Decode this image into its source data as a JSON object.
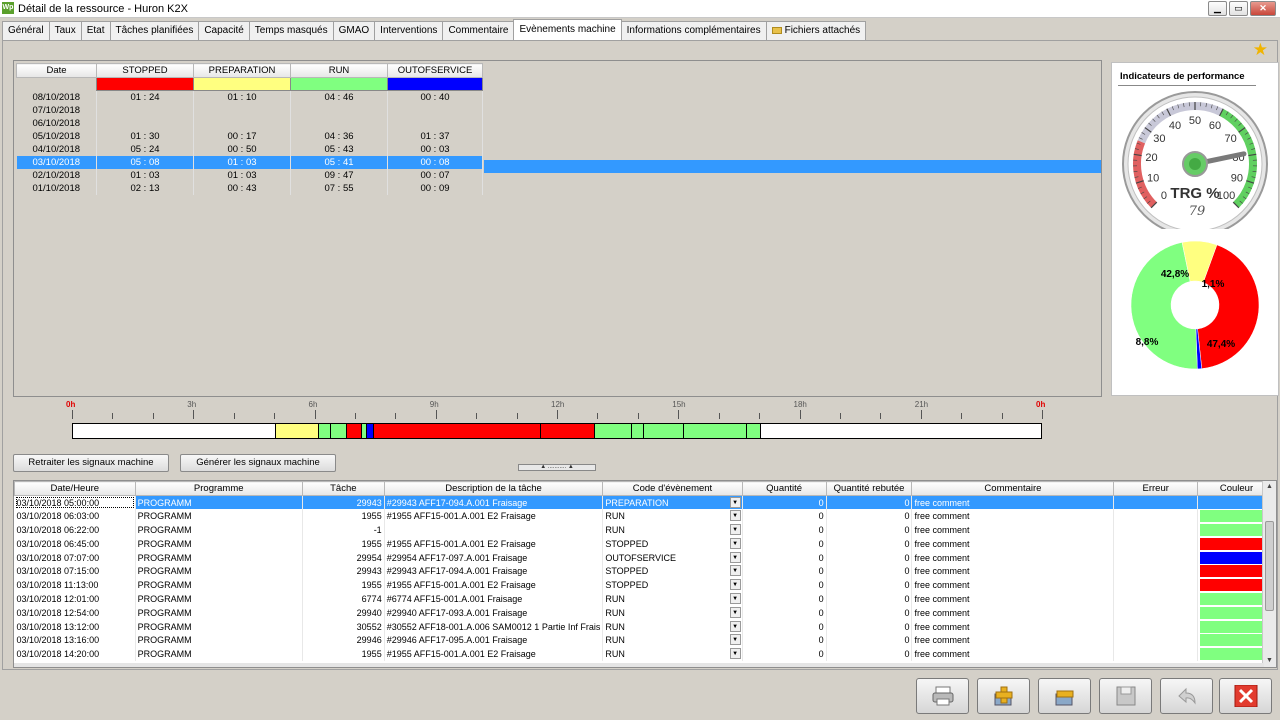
{
  "window": {
    "title": "Détail de la ressource - Huron K2X",
    "app_icon": "Wp"
  },
  "tabs": [
    {
      "label": "Général"
    },
    {
      "label": "Taux"
    },
    {
      "label": "Etat"
    },
    {
      "label": "Tâches planifiées"
    },
    {
      "label": "Capacité"
    },
    {
      "label": "Temps masqués"
    },
    {
      "label": "GMAO"
    },
    {
      "label": "Interventions"
    },
    {
      "label": "Commentaire"
    },
    {
      "label": "Evènements machine"
    },
    {
      "label": "Informations complémentaires"
    },
    {
      "label": "Fichiers attachés"
    }
  ],
  "active_tab": "Evènements machine",
  "summary": {
    "headers": [
      "Date",
      "STOPPED",
      "PREPARATION",
      "RUN",
      "OUTOFSERVICE"
    ],
    "colors": [
      "#ff0000",
      "#ffff80",
      "#80ff80",
      "#0000ff"
    ],
    "rows": [
      [
        "08/10/2018",
        "01 : 24",
        "01 : 10",
        "04 : 46",
        "00 : 40"
      ],
      [
        "07/10/2018",
        "",
        "",
        "",
        ""
      ],
      [
        "06/10/2018",
        "",
        "",
        "",
        ""
      ],
      [
        "05/10/2018",
        "01 : 30",
        "00 : 17",
        "04 : 36",
        "01 : 37"
      ],
      [
        "04/10/2018",
        "05 : 24",
        "00 : 50",
        "05 : 43",
        "00 : 03"
      ],
      [
        "03/10/2018",
        "05 : 08",
        "01 : 03",
        "05 : 41",
        "00 : 08"
      ],
      [
        "02/10/2018",
        "01 : 03",
        "01 : 03",
        "09 : 47",
        "00 : 07"
      ],
      [
        "01/10/2018",
        "02 : 13",
        "00 : 43",
        "07 : 55",
        "00 : 09"
      ]
    ],
    "selected_index": 5
  },
  "performance": {
    "title": "Indicateurs de performance",
    "gauge": {
      "label": "TRG %",
      "value": 79,
      "value_text": "79",
      "ticks": [
        "0",
        "10",
        "20",
        "30",
        "40",
        "50",
        "60",
        "70",
        "80",
        "90",
        "100"
      ]
    },
    "donut": {
      "slices": [
        {
          "label": "42,8%",
          "value": 42.8,
          "color": "#ff0000"
        },
        {
          "label": "1,1%",
          "value": 1.1,
          "color": "#0000ff"
        },
        {
          "label": "47,4%",
          "value": 47.4,
          "color": "#80ff80"
        },
        {
          "label": "8,8%",
          "value": 8.8,
          "color": "#ffff80"
        }
      ]
    }
  },
  "timeline": {
    "labels": [
      "0h",
      "3h",
      "6h",
      "9h",
      "12h",
      "15h",
      "18h",
      "21h",
      "0h"
    ],
    "segments": [
      {
        "start": 5.0,
        "end": 6.05,
        "color": "#ffff80"
      },
      {
        "start": 6.05,
        "end": 6.37,
        "color": "#80ff80"
      },
      {
        "start": 6.37,
        "end": 6.75,
        "color": "#80ff80"
      },
      {
        "start": 6.75,
        "end": 7.12,
        "color": "#ff0000"
      },
      {
        "start": 7.12,
        "end": 7.25,
        "color": "#80ff80"
      },
      {
        "start": 7.25,
        "end": 7.42,
        "color": "#0000ff"
      },
      {
        "start": 7.42,
        "end": 11.55,
        "color": "#ff0000"
      },
      {
        "start": 11.55,
        "end": 12.9,
        "color": "#ff0000"
      },
      {
        "start": 12.9,
        "end": 13.8,
        "color": "#80ff80"
      },
      {
        "start": 13.8,
        "end": 14.1,
        "color": "#80ff80"
      },
      {
        "start": 14.1,
        "end": 15.1,
        "color": "#80ff80"
      },
      {
        "start": 15.1,
        "end": 16.65,
        "color": "#80ff80"
      },
      {
        "start": 16.65,
        "end": 17.0,
        "color": "#80ff80"
      }
    ]
  },
  "actions": {
    "retraiter": "Retraiter les signaux machine",
    "generer": "Générer les signaux machine"
  },
  "events": {
    "headers": [
      "Date/Heure",
      "Programme",
      "Tâche",
      "Description de la tâche",
      "Code d'évènement",
      "Quantité",
      "Quantité rebutée",
      "Commentaire",
      "Erreur",
      "Couleur"
    ],
    "rows": [
      {
        "datetime": "03/10/2018 05:00:00",
        "programme": "PROGRAMM",
        "tache": "29943",
        "description": "#29943 AFF17-094.A.001 Fraisage",
        "code": "PREPARATION",
        "quantite": "0",
        "rebut": "0",
        "commentaire": "free comment",
        "erreur": "",
        "color": ""
      },
      {
        "datetime": "03/10/2018 06:03:00",
        "programme": "PROGRAMM",
        "tache": "1955",
        "description": "#1955 AFF15-001.A.001 E2 Fraisage",
        "code": "RUN",
        "quantite": "0",
        "rebut": "0",
        "commentaire": "free comment",
        "erreur": "",
        "color": "#80ff80"
      },
      {
        "datetime": "03/10/2018 06:22:00",
        "programme": "PROGRAMM",
        "tache": "-1",
        "description": "",
        "code": "RUN",
        "quantite": "0",
        "rebut": "0",
        "commentaire": "free comment",
        "erreur": "",
        "color": "#80ff80"
      },
      {
        "datetime": "03/10/2018 06:45:00",
        "programme": "PROGRAMM",
        "tache": "1955",
        "description": "#1955 AFF15-001.A.001 E2 Fraisage",
        "code": "STOPPED",
        "quantite": "0",
        "rebut": "0",
        "commentaire": "free comment",
        "erreur": "",
        "color": "#ff0000"
      },
      {
        "datetime": "03/10/2018 07:07:00",
        "programme": "PROGRAMM",
        "tache": "29954",
        "description": "#29954 AFF17-097.A.001 Fraisage",
        "code": "OUTOFSERVICE",
        "quantite": "0",
        "rebut": "0",
        "commentaire": "free comment",
        "erreur": "",
        "color": "#0000ff"
      },
      {
        "datetime": "03/10/2018 07:15:00",
        "programme": "PROGRAMM",
        "tache": "29943",
        "description": "#29943 AFF17-094.A.001 Fraisage",
        "code": "STOPPED",
        "quantite": "0",
        "rebut": "0",
        "commentaire": "free comment",
        "erreur": "",
        "color": "#ff0000"
      },
      {
        "datetime": "03/10/2018 11:13:00",
        "programme": "PROGRAMM",
        "tache": "1955",
        "description": "#1955 AFF15-001.A.001 E2 Fraisage",
        "code": "STOPPED",
        "quantite": "0",
        "rebut": "0",
        "commentaire": "free comment",
        "erreur": "",
        "color": "#ff0000"
      },
      {
        "datetime": "03/10/2018 12:01:00",
        "programme": "PROGRAMM",
        "tache": "6774",
        "description": "#6774 AFF15-001.A.001 Fraisage",
        "code": "RUN",
        "quantite": "0",
        "rebut": "0",
        "commentaire": "free comment",
        "erreur": "",
        "color": "#80ff80"
      },
      {
        "datetime": "03/10/2018 12:54:00",
        "programme": "PROGRAMM",
        "tache": "29940",
        "description": "#29940 AFF17-093.A.001 Fraisage",
        "code": "RUN",
        "quantite": "0",
        "rebut": "0",
        "commentaire": "free comment",
        "erreur": "",
        "color": "#80ff80"
      },
      {
        "datetime": "03/10/2018 13:12:00",
        "programme": "PROGRAMM",
        "tache": "30552",
        "description": "#30552 AFF18-001.A.006 SAM0012 1 Partie Inf Frais",
        "code": "RUN",
        "quantite": "0",
        "rebut": "0",
        "commentaire": "free comment",
        "erreur": "",
        "color": "#80ff80"
      },
      {
        "datetime": "03/10/2018 13:16:00",
        "programme": "PROGRAMM",
        "tache": "29946",
        "description": "#29946 AFF17-095.A.001 Fraisage",
        "code": "RUN",
        "quantite": "0",
        "rebut": "0",
        "commentaire": "free comment",
        "erreur": "",
        "color": "#80ff80"
      },
      {
        "datetime": "03/10/2018 14:20:00",
        "programme": "PROGRAMM",
        "tache": "1955",
        "description": "#1955 AFF15-001.A.001 E2 Fraisage",
        "code": "RUN",
        "quantite": "0",
        "rebut": "0",
        "commentaire": "free comment",
        "erreur": "",
        "color": "#80ff80"
      }
    ],
    "selected_index": 0
  },
  "toolbar": {
    "buttons": [
      {
        "label": "Imprimer",
        "icon": "printer-icon",
        "enabled": true
      },
      {
        "label": "Ajouter",
        "icon": "add-icon",
        "enabled": true
      },
      {
        "label": "Supprimer",
        "icon": "delete-icon",
        "enabled": true
      },
      {
        "label": "Valider",
        "icon": "save-icon",
        "enabled": false
      },
      {
        "label": "Annuler",
        "icon": "undo-icon",
        "enabled": false
      },
      {
        "label": "Fermer",
        "icon": "close-icon",
        "enabled": true
      }
    ]
  }
}
